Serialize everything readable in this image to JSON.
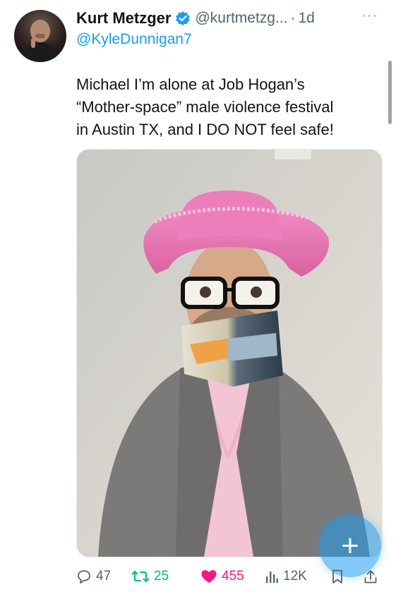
{
  "tweet": {
    "author_name": "Kurt Metzger",
    "author_handle": "@kurtmetzg...",
    "separator": "·",
    "time": "1d",
    "more_label": "···",
    "reply_to": "@KyleDunnigan7",
    "text_lines": [
      "Michael I’m alone at Job Hogan’s",
      "“Mother-space” male violence festival",
      "in Austin TX, and I DO NOT feel safe!"
    ]
  },
  "actions": {
    "replies": "47",
    "retweets": "25",
    "likes": "455",
    "views": "12K"
  },
  "fab": {
    "label": "+"
  },
  "colors": {
    "accent": "#1d9bf0",
    "retweet": "#00ba7c",
    "like": "#f91880",
    "muted": "#536471"
  },
  "icons": {
    "verified": "verified-badge-icon",
    "reply": "reply-icon",
    "retweet": "retweet-icon",
    "like": "heart-icon",
    "views": "views-icon",
    "bookmark": "bookmark-icon",
    "share": "share-icon",
    "compose": "compose-plus-icon"
  }
}
